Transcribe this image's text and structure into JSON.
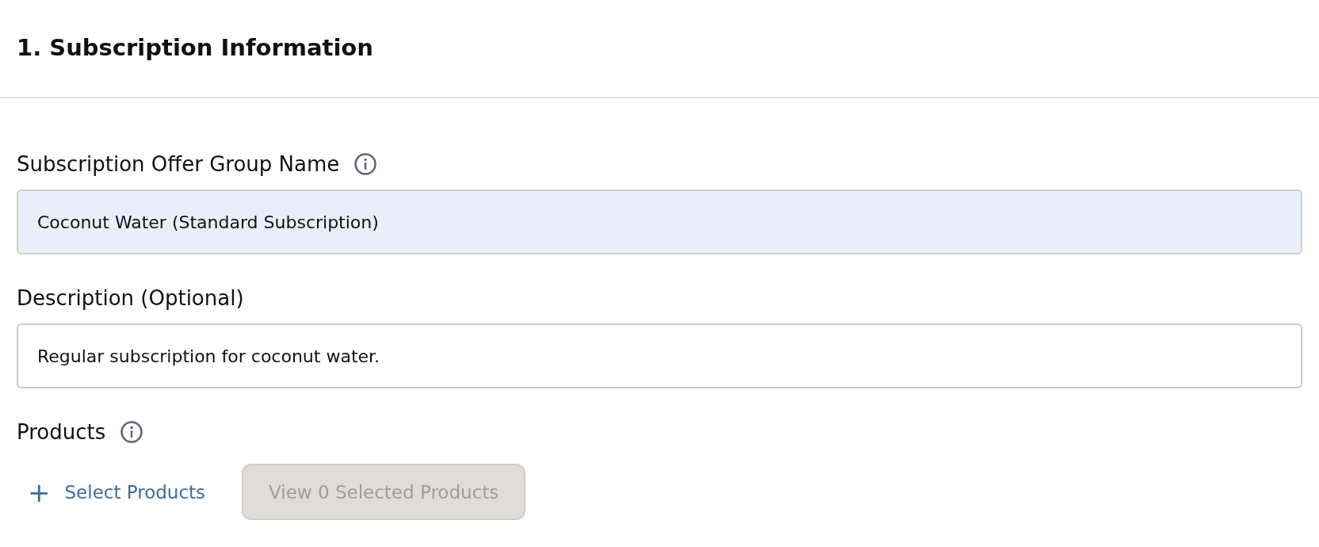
{
  "section": {
    "title": "1. Subscription Information"
  },
  "fields": [
    {
      "label": "Subscription Offer Group Name",
      "info": true,
      "value": "Coconut Water (Standard Subscription)",
      "highlighted": true
    },
    {
      "label": "Description (Optional)",
      "info": false,
      "value": "Regular subscription for coconut water.",
      "highlighted": false
    }
  ],
  "products": {
    "label": "Products",
    "info": true,
    "select_button": "+",
    "select_label": "Select Products",
    "view_button": {
      "label": "View 0 Selected Products",
      "disabled": true
    }
  }
}
